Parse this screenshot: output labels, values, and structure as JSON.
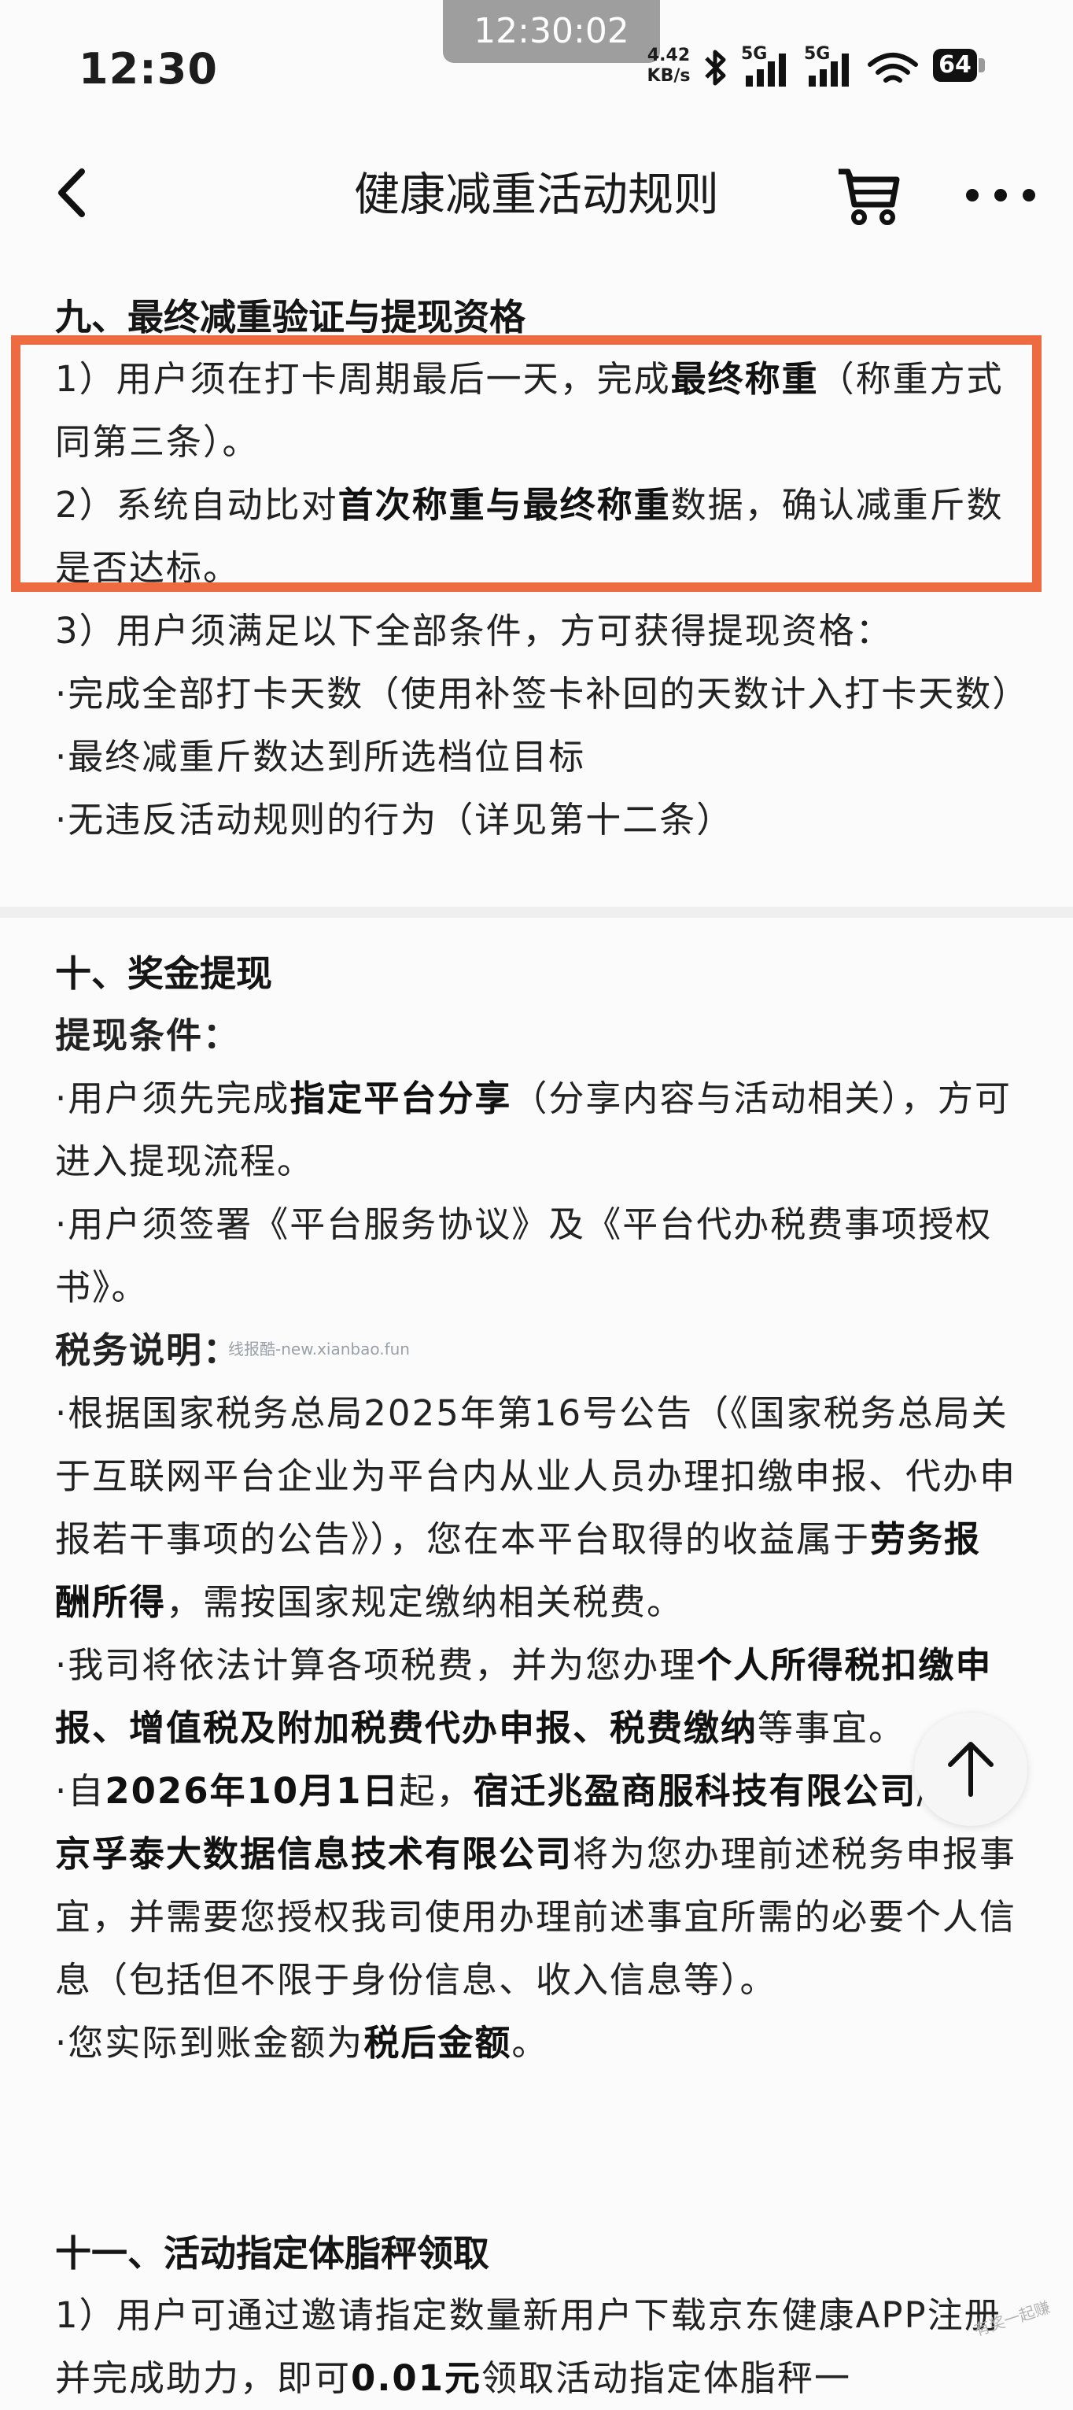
{
  "status_bar": {
    "time": "12:30",
    "recording_time": "12:30:02",
    "net_speed_value": "4.42",
    "net_speed_unit": "KB/s",
    "signal_1": "5G",
    "signal_2": "5G",
    "battery": "64",
    "icons": [
      "bluetooth-icon",
      "signal-icon",
      "signal-icon",
      "wifi-icon",
      "battery-icon"
    ]
  },
  "nav": {
    "title": "健康减重活动规则",
    "icons": [
      "back-icon",
      "cart-icon",
      "more-icon"
    ]
  },
  "section9": {
    "heading": "九、最终减重验证与提现资格",
    "item1_a": "1）用户须在打卡周期最后一天，完成",
    "item1_b": "最终称重",
    "item1_c": "（称重方式同第三条）。",
    "item2_a": "2）系统自动比对",
    "item2_b": "首次称重与最终称重",
    "item2_c": "数据，确认减重斤数是否达标。",
    "item3": "3）用户须满足以下全部条件，方可获得提现资格：",
    "cond1": "·完成全部打卡天数（使用补签卡补回的天数计入打卡天数）",
    "cond2": "·最终减重斤数达到所选档位目标",
    "cond3": "·无违反活动规则的行为（详见第十二条）"
  },
  "section10": {
    "heading": "十、奖金提现",
    "sub1": "提现条件：",
    "c1_a": "·用户须先完成",
    "c1_b": "指定平台分享",
    "c1_c": "（分享内容与活动相关），方可进入提现流程。",
    "c2": "·用户须签署《平台服务协议》及《平台代办税费事项授权书》。",
    "sub2": "税务说明：",
    "t1_a": "·根据国家税务总局2025年第16号公告（《国家税务总局关于互联网平台企业为平台内从业人员办理扣缴申报、代办申报若干事项的公告》），您在本平台取得的收益属于",
    "t1_b": "劳务报酬所得",
    "t1_c": "，需按国家规定缴纳相关税费。",
    "t2_a": "·我司将依法计算各项税费，并为您办理",
    "t2_b": "个人所得税扣缴申报、增值税及附加税费代办申报、税费缴纳",
    "t2_c": "等事宜。",
    "t3_a": "·自",
    "t3_b": "2026年10月1日",
    "t3_c": "起，",
    "t3_d": "宿迁兆盈商服科技有限公司",
    "t3_e": "/",
    "t3_f": "宿迁京孚泰大数据信息技术有限公司",
    "t3_g": "将为您办理前述税务申报事宜，并需要您授权我司使用办理前述事宜所需的必要个人信息（包括但不限于身份信息、收入信息等）。",
    "t4_a": "·您实际到账金额为",
    "t4_b": "税后金额",
    "t4_c": "。"
  },
  "section11": {
    "heading": "十一、活动指定体脂秤领取",
    "p1_a": "1）用户可通过邀请指定数量新用户下载京东健康APP注册并完成助力，即可",
    "p1_b": "0.01元",
    "p1_c": "领取活动指定体脂秤一"
  },
  "watermark": "线报酷-new.xianbao.fun",
  "corner_watermark": "有奖一起赚"
}
